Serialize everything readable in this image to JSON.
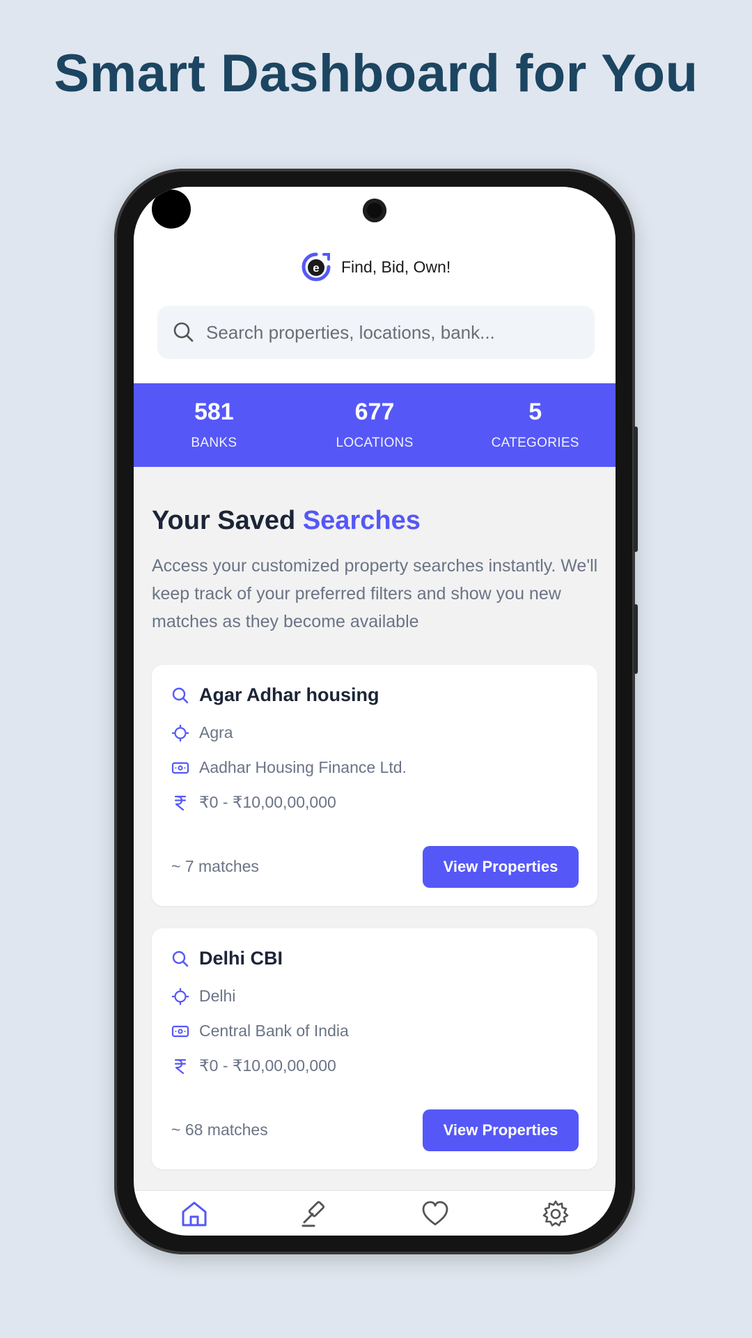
{
  "headline": "Smart Dashboard for You",
  "app": {
    "tagline": "Find, Bid, Own!",
    "logo_letter": "e"
  },
  "search": {
    "placeholder": "Search properties, locations, bank..."
  },
  "stats": [
    {
      "value": "581",
      "label": "BANKS"
    },
    {
      "value": "677",
      "label": "LOCATIONS"
    },
    {
      "value": "5",
      "label": "CATEGORIES"
    }
  ],
  "saved": {
    "title_part1": "Your Saved",
    "title_part2": "Searches",
    "description": "Access your customized property searches instantly. We'll keep track of your preferred filters and show you new matches as they become available"
  },
  "cards": [
    {
      "name": "Agar Adhar housing",
      "location": "Agra",
      "bank": "Aadhar Housing Finance Ltd.",
      "price_range": "₹0 - ₹10,00,00,000",
      "matches": "~ 7 matches",
      "button": "View Properties"
    },
    {
      "name": "Delhi CBI",
      "location": "Delhi",
      "bank": "Central Bank of India",
      "price_range": "₹0 - ₹10,00,00,000",
      "matches": "~ 68 matches",
      "button": "View Properties"
    }
  ],
  "nav": [
    "home-icon",
    "gavel-icon",
    "heart-icon",
    "gear-icon"
  ],
  "colors": {
    "accent": "#5558f7",
    "headline": "#1c4561",
    "background": "#dfe6ef"
  }
}
